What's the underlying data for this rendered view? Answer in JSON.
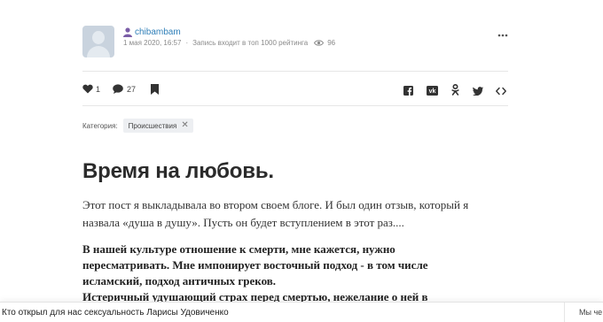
{
  "post": {
    "author": "chibambam",
    "date": "1 мая 2020, 16:57",
    "rating_note": "Запись входит в топ 1000 рейтинга",
    "views": "96"
  },
  "actions": {
    "likes": "1",
    "comments": "27"
  },
  "category": {
    "label": "Категория:",
    "tag": "Происшествия"
  },
  "article": {
    "title": "Время на любовь.",
    "intro": "Этот пост я выкладывала во втором своем блоге. И был один отзыв, который я назвала «душа в душу». Пусть он будет вступлением в этот раз....",
    "bold_lines": [
      "В нашей культуре отношение к смерти, мне кажется, нужно",
      "пересматривать. Мне импонирует восточный подход - в том числе",
      "исламский, подход античных греков.",
      "Истеричный удушающий страх перед смертью, нежелание о ней в"
    ]
  },
  "bottom": {
    "link": "Кто открыл для нас сексуальность Ларисы Удовиченко",
    "right_text": "Мы че"
  },
  "icons": [
    "user-icon",
    "eye-icon",
    "more-icon",
    "heart-icon",
    "comment-icon",
    "bookmark-icon",
    "facebook-icon",
    "vk-icon",
    "odnoklassniki-icon",
    "twitter-icon",
    "embed-code-icon",
    "close-icon"
  ],
  "colors": {
    "accent": "#2f7fb8",
    "icon": "#333333",
    "chip_bg": "#edeff2"
  }
}
